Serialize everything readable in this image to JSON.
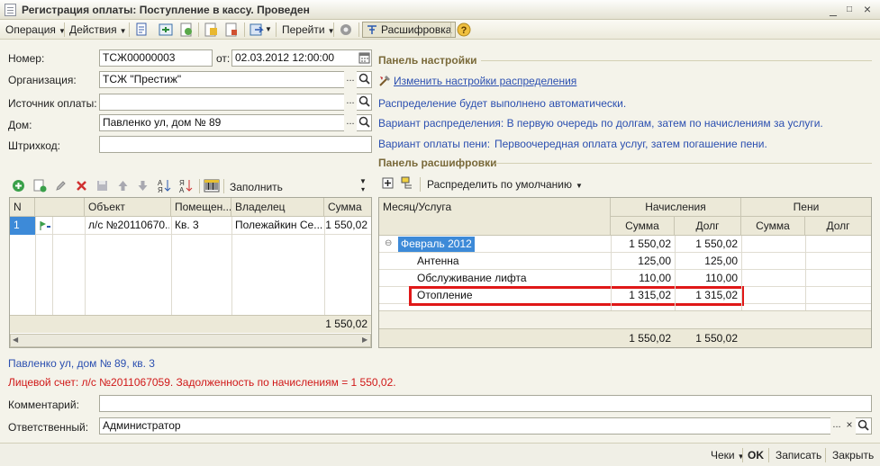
{
  "window": {
    "title": "Регистрация оплаты: Поступление в кассу. Проведен"
  },
  "toolbar": {
    "operation": "Операция",
    "actions": "Действия",
    "goto": "Перейти",
    "decode": "Расшифровка"
  },
  "form": {
    "number_label": "Номер:",
    "number_value": "ТСЖ00000003",
    "from_label": "от:",
    "date_value": "02.03.2012 12:00:00",
    "org_label": "Организация:",
    "org_value": "ТСЖ \"Престиж\"",
    "source_label": "Источник оплаты:",
    "source_value": "",
    "house_label": "Дом:",
    "house_value": "Павленко ул, дом № 89",
    "barcode_label": "Штрихкод:",
    "barcode_value": ""
  },
  "settings_panel": {
    "title": "Панель настройки",
    "change_link": "Изменить настройки распределения",
    "auto_text": "Распределение будет выполнено автоматически.",
    "variant_text": "Вариант распределения: В первую очередь по долгам, затем по начислениям за услуги.",
    "penalty_label": "Вариант оплаты пени:",
    "penalty_value": "Первоочередная оплата услуг, затем погашение пени."
  },
  "left_grid": {
    "fill_button": "Заполнить",
    "headers": {
      "n": "N",
      "object": "Объект",
      "room": "Помещен...",
      "owner": "Владелец",
      "sum": "Сумма"
    },
    "row": {
      "n": "1",
      "object": "л/с №20110670...",
      "room": "Кв. 3",
      "owner": "Полежайкин Се...",
      "sum": "1 550,02"
    },
    "total": "1 550,02"
  },
  "decode_panel": {
    "title": "Панель расшифровки",
    "distribute_button": "Распределить по умолчанию",
    "headers": {
      "month_service": "Месяц/Услуга",
      "accruals": "Начисления",
      "penalties": "Пени",
      "sum": "Сумма",
      "debt": "Долг",
      "pen_sum": "Сумма",
      "pen_debt": "Долг"
    },
    "group": {
      "name": "Февраль 2012",
      "sum": "1 550,02",
      "debt": "1 550,02"
    },
    "rows": [
      {
        "name": "Антенна",
        "sum": "125,00",
        "debt": "125,00"
      },
      {
        "name": "Обслуживание лифта",
        "sum": "110,00",
        "debt": "110,00"
      },
      {
        "name": "Отопление",
        "sum": "1 315,02",
        "debt": "1 315,02"
      }
    ],
    "total_sum": "1 550,02",
    "total_debt": "1 550,02"
  },
  "info": {
    "address": "Павленко ул, дом № 89, кв. 3",
    "account": "Лицевой счет: л/с №2011067059. Задолженность по начислениям = 1 550,02."
  },
  "footer": {
    "comment_label": "Комментарий:",
    "comment_value": "",
    "responsible_label": "Ответственный:",
    "responsible_value": "Администратор"
  },
  "bottom": {
    "checks": "Чеки",
    "ok": "OK",
    "save": "Записать",
    "close": "Закрыть"
  },
  "colors": {
    "highlight": "#e01818",
    "selection": "#3d8ad8",
    "link": "#2b4fb0",
    "section": "#7a6a3a"
  }
}
